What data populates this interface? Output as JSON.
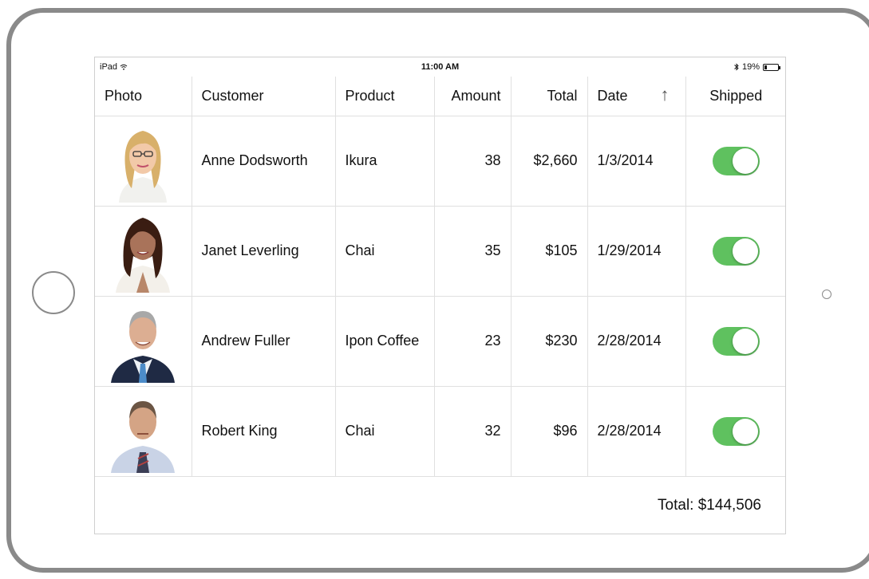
{
  "status_bar": {
    "device": "iPad",
    "time": "11:00 AM",
    "battery": "19%",
    "battery_level": 0.19
  },
  "columns": [
    "Photo",
    "Customer",
    "Product",
    "Amount",
    "Total",
    "Date",
    "Shipped"
  ],
  "sort": {
    "column": "Date",
    "direction": "ascending",
    "indicator": "↑"
  },
  "rows": [
    {
      "customer": "Anne Dodsworth",
      "product": "Ikura",
      "amount": "38",
      "total": "$2,660",
      "date": "1/3/2014",
      "shipped": true,
      "photo": "woman-blonde-glasses"
    },
    {
      "customer": "Janet Leverling",
      "product": "Chai",
      "amount": "35",
      "total": "$105",
      "date": "1/29/2014",
      "shipped": true,
      "photo": "woman-dark-hair"
    },
    {
      "customer": "Andrew Fuller",
      "product": "Ipon Coffee",
      "amount": "23",
      "total": "$230",
      "date": "2/28/2014",
      "shipped": true,
      "photo": "man-gray-hair-suit"
    },
    {
      "customer": "Robert King",
      "product": "Chai",
      "amount": "32",
      "total": "$96",
      "date": "2/28/2014",
      "shipped": true,
      "photo": "man-shirt-tie"
    }
  ],
  "footer": {
    "total_label": "Total: $144,506"
  },
  "colors": {
    "toggle_on": "#5fc15f",
    "grid_line": "#e0e0e0",
    "device_frame": "#8a8a8a"
  }
}
